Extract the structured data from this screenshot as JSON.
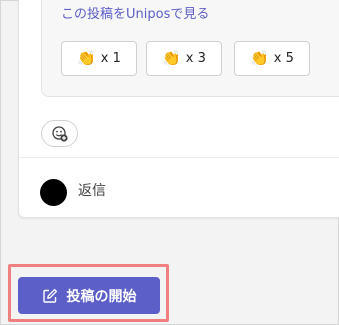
{
  "message": {
    "view_link": "この投稿をUniposで見る",
    "clap_buttons": [
      {
        "icon": "clap-icon",
        "label": "x 1"
      },
      {
        "icon": "clap-icon",
        "label": "x 3"
      },
      {
        "icon": "clap-icon",
        "label": "x 5"
      }
    ],
    "reply_label": "返信"
  },
  "compose": {
    "new_post_label": "投稿の開始",
    "accent": "#5b5fc7"
  },
  "highlight_color": "#f08080"
}
